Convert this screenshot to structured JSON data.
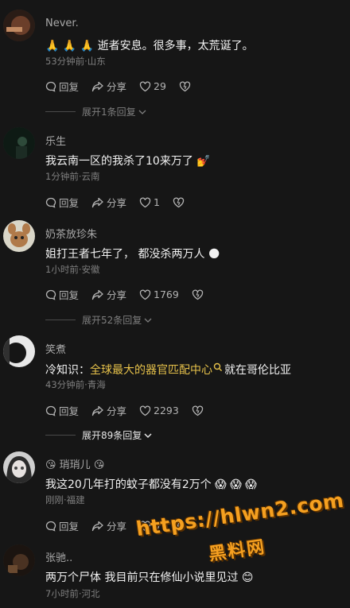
{
  "comments": [
    {
      "username": "Never.",
      "text": "🙏 🙏 🙏 逝者安息。很多事，太荒诞了。",
      "meta": "53分钟前·山东",
      "reply_label": "回复",
      "share_label": "分享",
      "likes": "29"
    },
    {
      "username": "乐生",
      "text": "我云南一区的我杀了10来万了 💅",
      "meta": "1分钟前·云南",
      "reply_label": "回复",
      "share_label": "分享",
      "likes": "1"
    },
    {
      "username": "奶茶放珍朱",
      "text": "姐打王者七年了， 都没杀两万人 🌑",
      "meta": "1小时前·安徽",
      "reply_label": "回复",
      "share_label": "分享",
      "likes": "1769"
    },
    {
      "username": "笑煮",
      "text_prefix": "冷知识：",
      "text_link": "全球最大的器官匹配中心",
      "text_suffix": "就在哥伦比亚",
      "meta": "43分钟前·青海",
      "reply_label": "回复",
      "share_label": "分享",
      "likes": "2293"
    },
    {
      "username": "😘 琑琑儿 😘",
      "text": "我这20几年打的蚊子都没有2万个 😱  😱  😱",
      "meta": "刚刚·福建",
      "reply_label": "回复",
      "share_label": "分享",
      "likes": "0"
    },
    {
      "username": "张驰..",
      "text": "两万个尸体 我目前只在修仙小说里见过 😊",
      "meta": "7小时前·河北"
    }
  ],
  "expanders": [
    {
      "label": "展开1条回复"
    },
    {
      "label": "展开52条回复"
    },
    {
      "label": "展开89条回复"
    }
  ],
  "watermark": {
    "line1": "https://hlwn2.com",
    "line2": "黑料网"
  },
  "colors": {
    "background": "#161616",
    "link": "#e6c14a",
    "watermark": "#f5a020"
  }
}
